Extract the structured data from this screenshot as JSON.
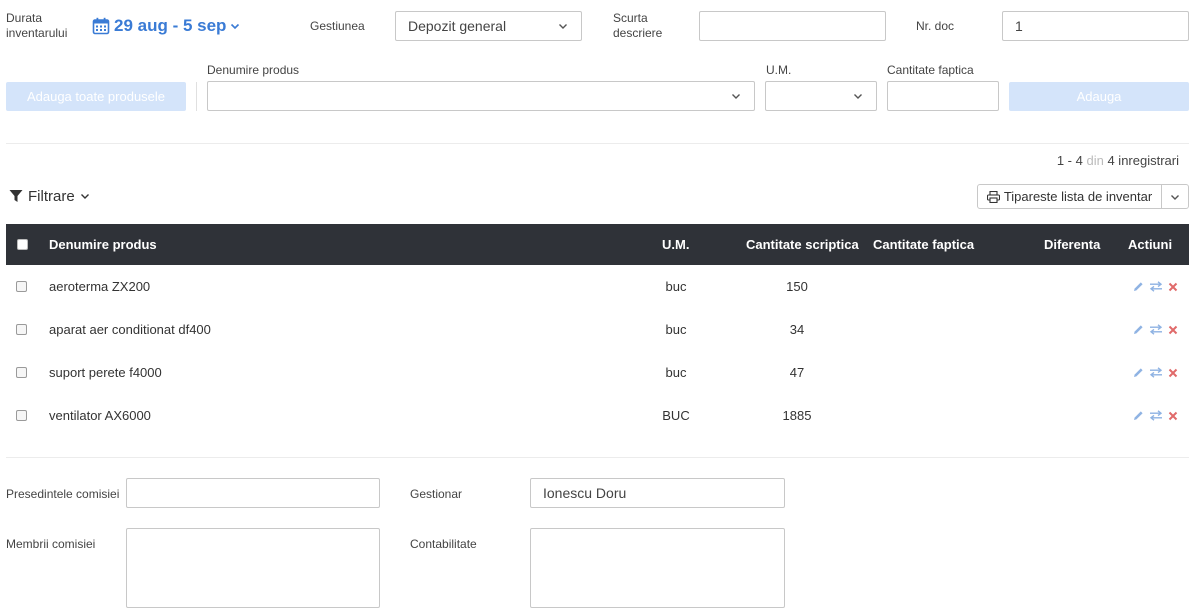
{
  "header": {
    "duration_label": "Durata inventarului",
    "date_range": "29 aug - 5 sep",
    "gestiune_label": "Gestiunea",
    "gestiune_value": "Depozit general",
    "short_desc_label": "Scurta descriere",
    "short_desc_value": "",
    "nr_doc_label": "Nr. doc",
    "nr_doc_value": "1"
  },
  "add_row": {
    "add_all_label": "Adauga toate produsele",
    "product_label": "Denumire produs",
    "um_label": "U.M.",
    "qty_label": "Cantitate faptica",
    "add_label": "Adauga"
  },
  "pagination": {
    "range": "1 - 4",
    "of": "din",
    "total": "4 inregistrari"
  },
  "toolbar": {
    "filter_label": "Filtrare",
    "print_label": "Tipareste lista de inventar"
  },
  "table": {
    "headers": {
      "name": "Denumire produs",
      "um": "U.M.",
      "scriptic": "Cantitate scriptica",
      "faptic": "Cantitate faptica",
      "diff": "Diferenta",
      "actions": "Actiuni"
    },
    "rows": [
      {
        "name": "aeroterma ZX200",
        "um": "buc",
        "scriptic": "150",
        "faptic": "",
        "diff": ""
      },
      {
        "name": "aparat aer conditionat df400",
        "um": "buc",
        "scriptic": "34",
        "faptic": "",
        "diff": ""
      },
      {
        "name": "suport perete f4000",
        "um": "buc",
        "scriptic": "47",
        "faptic": "",
        "diff": ""
      },
      {
        "name": "ventilator AX6000",
        "um": "BUC",
        "scriptic": "1885",
        "faptic": "",
        "diff": ""
      }
    ]
  },
  "footer": {
    "president_label": "Presedintele comisiei",
    "president_value": "",
    "gestionar_label": "Gestionar",
    "gestionar_value": "Ionescu Doru",
    "members_label": "Membrii comisiei",
    "members_value": "",
    "accounting_label": "Contabilitate",
    "accounting_value": ""
  },
  "colors": {
    "accent": "#3a7bd5",
    "header_bg": "#2f3238",
    "disabled_btn": "#d4e4fa",
    "delete_icon": "#e06a6a",
    "edit_icon": "#8fb3e3"
  }
}
